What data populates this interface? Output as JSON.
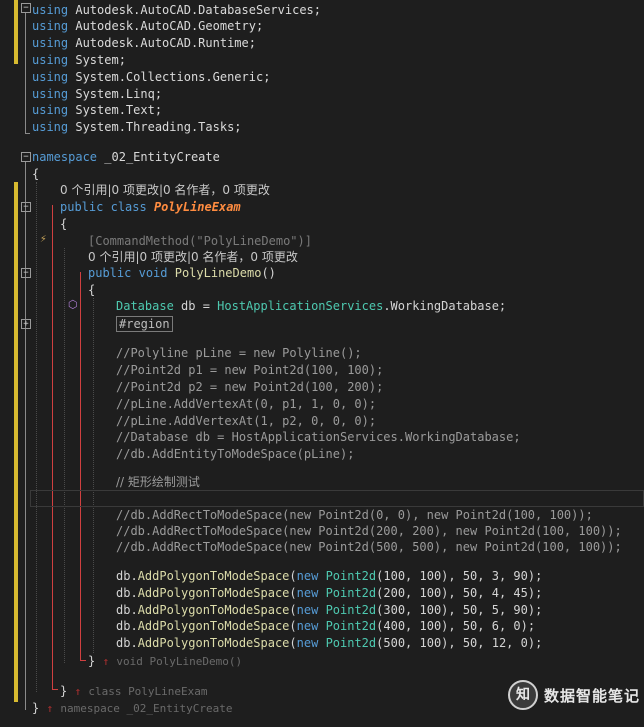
{
  "usings": [
    {
      "kw": "using",
      "ns": "Autodesk.AutoCAD.DatabaseServices;"
    },
    {
      "kw": "using",
      "ns": "Autodesk.AutoCAD.Geometry;"
    },
    {
      "kw": "using",
      "ns": "Autodesk.AutoCAD.Runtime;"
    },
    {
      "kw": "using",
      "ns": "System;"
    },
    {
      "kw": "using",
      "ns": "System.Collections.Generic;"
    },
    {
      "kw": "using",
      "ns": "System.Linq;"
    },
    {
      "kw": "using",
      "ns": "System.Text;"
    },
    {
      "kw": "using",
      "ns": "System.Threading.Tasks;"
    }
  ],
  "namespace": {
    "kw": "namespace",
    "name": "_02_EntityCreate"
  },
  "codelens_class": "0 个引用|0 项更改|0 名作者，0 项更改",
  "class_decl": {
    "kw1": "public",
    "kw2": "class",
    "name": "PolyLineExam"
  },
  "attribute": {
    "open": "[CommandMethod(",
    "arg": "\"PolyLineDemo\"",
    "close": ")]"
  },
  "codelens_method": "0 个引用|0 项更改|0 名作者，0 项更改",
  "method_decl": {
    "kw1": "public",
    "kw2": "void",
    "name": "PolyLineDemo",
    "parens": "()"
  },
  "db_line": {
    "type": "Database",
    "var": " db = ",
    "cls": "HostApplicationServices",
    "member": ".WorkingDatabase;"
  },
  "region": "#region",
  "comments_1": [
    "//Polyline pLine = new Polyline();",
    "//Point2d p1 = new Point2d(100, 100);",
    "//Point2d p2 = new Point2d(100, 200);",
    "//pLine.AddVertexAt(0, p1, 1, 0, 0);",
    "//pLine.AddVertexAt(1, p2, 0, 0, 0);",
    "//Database db = HostApplicationServices.WorkingDatabase;",
    "//db.AddEntityToModeSpace(pLine);"
  ],
  "comment_rect": "// 矩形绘制测试",
  "comments_2": [
    "//db.AddRectToModeSpace(new Point2d(0, 0), new Point2d(100, 100));",
    "//db.AddRectToModeSpace(new Point2d(200, 200), new Point2d(100, 100));",
    "//db.AddRectToModeSpace(new Point2d(500, 500), new Point2d(100, 100));"
  ],
  "polygon_calls": [
    {
      "obj": "db.",
      "fn": "AddPolygonToModeSpace",
      "a": "(",
      "kw": "new",
      "ty": "Point2d",
      "args": "(100, 100), 50, 3, 90);"
    },
    {
      "obj": "db.",
      "fn": "AddPolygonToModeSpace",
      "a": "(",
      "kw": "new",
      "ty": "Point2d",
      "args": "(200, 100), 50, 4, 45);"
    },
    {
      "obj": "db.",
      "fn": "AddPolygonToModeSpace",
      "a": "(",
      "kw": "new",
      "ty": "Point2d",
      "args": "(300, 100), 50, 5, 90);"
    },
    {
      "obj": "db.",
      "fn": "AddPolygonToModeSpace",
      "a": "(",
      "kw": "new",
      "ty": "Point2d",
      "args": "(400, 100), 50, 6, 0);"
    },
    {
      "obj": "db.",
      "fn": "AddPolygonToModeSpace",
      "a": "(",
      "kw": "new",
      "ty": "Point2d",
      "args": "(500, 100), 50, 12, 0);"
    }
  ],
  "end_method_hint": "void PolyLineDemo()",
  "end_class_hint": "class PolyLineExam",
  "end_ns_hint": "namespace _02_EntityCreate",
  "brace_open": "{",
  "brace_close": "}",
  "hint_arrow": "↑",
  "collapse_minus": "−",
  "collapse_plus": "+",
  "bulb_glyph": "⚡",
  "cube_glyph": "⬡",
  "watermark": {
    "logo": "知",
    "text": "数据智能笔记"
  },
  "colors": {
    "background": "#1e1e1e",
    "keyword": "#569cd6",
    "type": "#4ec9b0",
    "class_name": "#ff8c40",
    "method": "#dcdcaa",
    "comment": "#57a64a",
    "change_bar": "#d7ba30"
  }
}
